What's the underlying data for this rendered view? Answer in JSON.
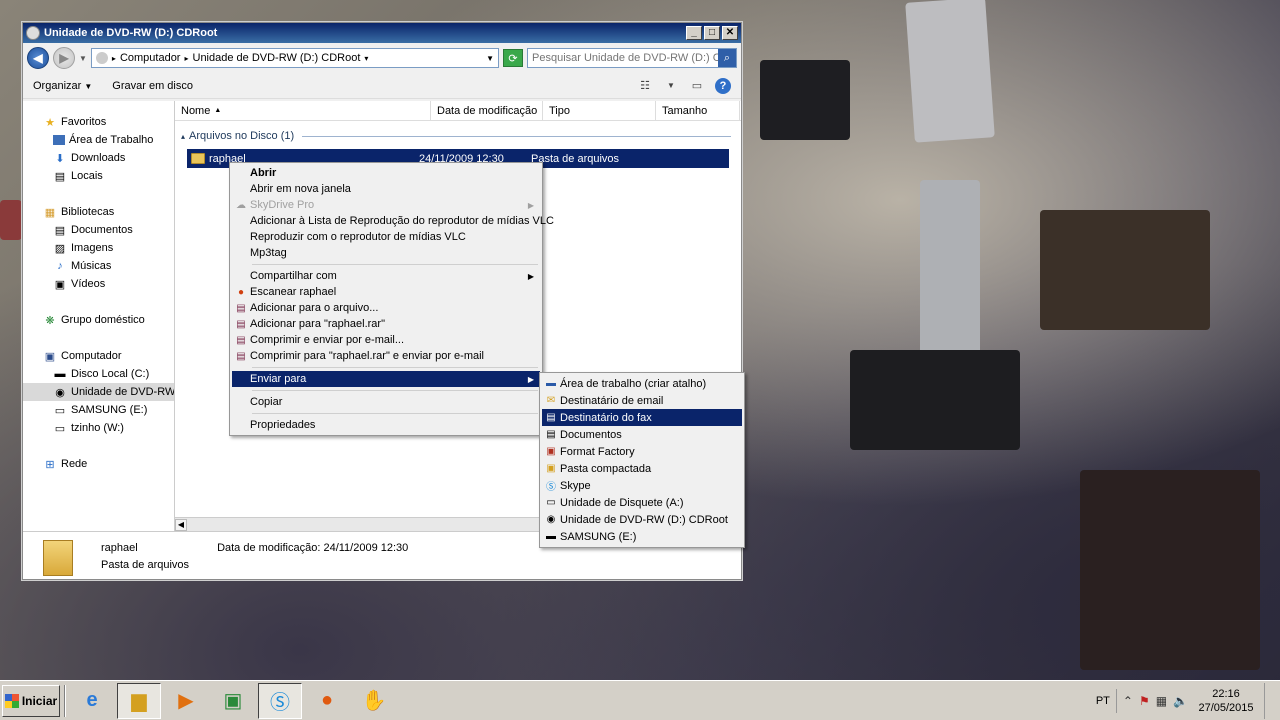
{
  "window": {
    "title": "Unidade de DVD-RW (D:) CDRoot",
    "controls": {
      "minimize": "_",
      "maximize": "□",
      "close": "✕"
    }
  },
  "address": {
    "segments": [
      "Computador",
      "Unidade de DVD-RW (D:) CDRoot"
    ],
    "search_placeholder": "Pesquisar Unidade de DVD-RW (D:) CD..."
  },
  "toolbar": {
    "organize": "Organizar",
    "burn": "Gravar em disco"
  },
  "nav": {
    "favorites": {
      "label": "Favoritos",
      "items": [
        "Área de Trabalho",
        "Downloads",
        "Locais"
      ]
    },
    "libraries": {
      "label": "Bibliotecas",
      "items": [
        "Documentos",
        "Imagens",
        "Músicas",
        "Vídeos"
      ]
    },
    "homegroup": "Grupo doméstico",
    "computer": {
      "label": "Computador",
      "items": [
        "Disco Local (C:)",
        "Unidade de DVD-RW (D:",
        "SAMSUNG (E:)",
        "tzinho (W:)"
      ]
    },
    "network": "Rede"
  },
  "columns": [
    "Nome",
    "Data de modificação",
    "Tipo",
    "Tamanho"
  ],
  "group_label": "Arquivos no Disco (1)",
  "file": {
    "name": "raphael",
    "date": "24/11/2009 12:30",
    "type": "Pasta de arquivos"
  },
  "details": {
    "name": "raphael",
    "type": "Pasta de arquivos",
    "date_label": "Data de modificação:",
    "date_value": "24/11/2009 12:30"
  },
  "context_menu": {
    "open": "Abrir",
    "open_new": "Abrir em nova janela",
    "skydrive": "SkyDrive Pro",
    "vlc_add": "Adicionar à Lista de Reprodução do reprodutor de mídias VLC",
    "vlc_play": "Reproduzir com o reprodutor de mídias VLC",
    "mp3tag": "Mp3tag",
    "share": "Compartilhar com",
    "scan": "Escanear raphael",
    "add_archive": "Adicionar para o arquivo...",
    "add_rar": "Adicionar para \"raphael.rar\"",
    "compress_email": "Comprimir e enviar por e-mail...",
    "compress_rar_email": "Comprimir para \"raphael.rar\" e enviar por e-mail",
    "send_to": "Enviar para",
    "copy": "Copiar",
    "properties": "Propriedades"
  },
  "send_to_menu": [
    "Área de trabalho (criar atalho)",
    "Destinatário de email",
    "Destinatário do fax",
    "Documentos",
    "Format Factory",
    "Pasta compactada",
    "Skype",
    "Unidade de Disquete (A:)",
    "Unidade de DVD-RW (D:) CDRoot",
    "SAMSUNG (E:)"
  ],
  "taskbar": {
    "start": "Iniciar",
    "language": "PT",
    "time": "22:16",
    "date": "27/05/2015"
  },
  "colors": {
    "selection": "#0a246a",
    "titlebar": "#0a246a"
  }
}
